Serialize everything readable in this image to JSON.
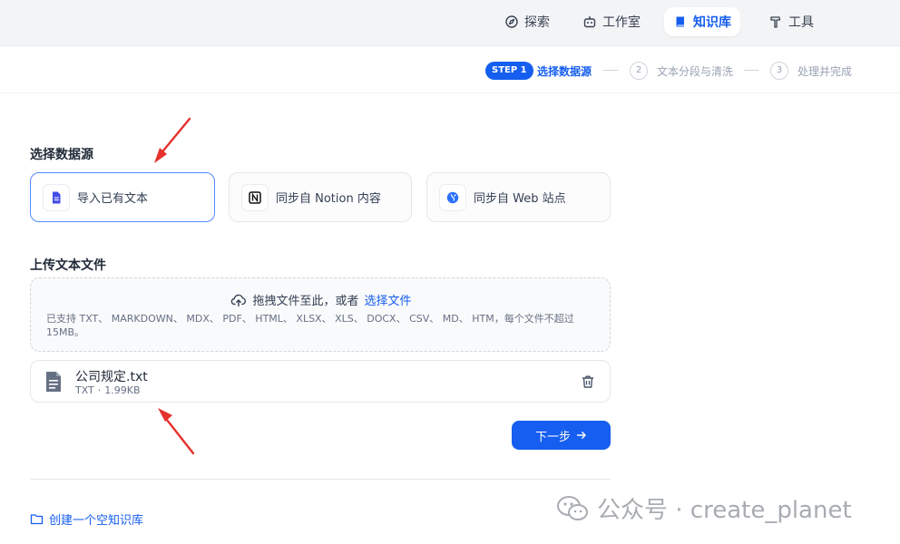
{
  "nav": {
    "items": [
      {
        "label": "探索",
        "icon": "compass-icon"
      },
      {
        "label": "工作室",
        "icon": "robot-icon"
      },
      {
        "label": "知识库",
        "icon": "book-icon",
        "active": true
      },
      {
        "label": "工具",
        "icon": "hammer-icon"
      }
    ]
  },
  "steps": [
    {
      "badge": "STEP 1",
      "label": "选择数据源",
      "active": true
    },
    {
      "number": "2",
      "label": "文本分段与清洗"
    },
    {
      "number": "3",
      "label": "处理并完成"
    }
  ],
  "datasource": {
    "title": "选择数据源",
    "options": [
      {
        "label": "导入已有文本",
        "icon": "file-text-icon",
        "selected": true
      },
      {
        "label": "同步自 Notion 内容",
        "icon": "notion-icon"
      },
      {
        "label": "同步自 Web 站点",
        "icon": "web-icon"
      }
    ]
  },
  "upload": {
    "title": "上传文本文件",
    "drag_text": "拖拽文件至此，或者",
    "select_link": "选择文件",
    "hint": "已支持 TXT、 MARKDOWN、 MDX、 PDF、 HTML、 XLSX、 XLS、 DOCX、 CSV、 MD、 HTM，每个文件不超过 15MB。"
  },
  "file": {
    "name": "公司规定.txt",
    "type": "TXT",
    "separator": "·",
    "size": "1.99KB"
  },
  "next_button": {
    "label": "下一步"
  },
  "create_empty": {
    "label": "创建一个空知识库"
  },
  "watermark": {
    "text": "公众号 · create_planet"
  },
  "colors": {
    "accent": "#155eef",
    "annotation_arrow": "#e5322d"
  }
}
